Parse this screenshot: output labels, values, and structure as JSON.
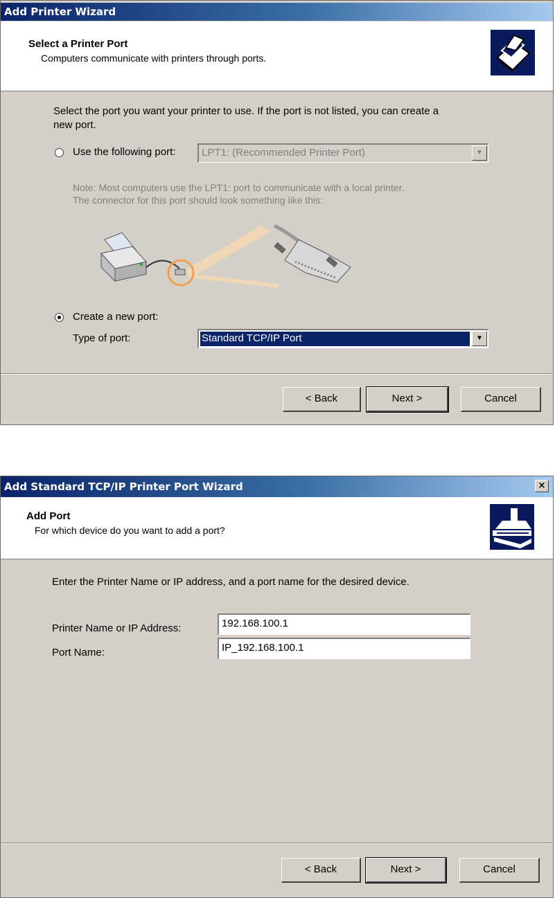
{
  "dialog1": {
    "title": "Add Printer Wizard",
    "header_title": "Select a Printer Port",
    "header_subtitle": "Computers communicate with printers through ports.",
    "instruction_line1": "Select the port you want your printer to use.  If the port is not listed, you can create a",
    "instruction_line2": "new port.",
    "use_port_label": "Use the following port:",
    "use_port_value": "LPT1: (Recommended Printer Port)",
    "note_line1": "Note: Most computers use the LPT1: port to communicate with a local printer.",
    "note_line2": "The connector for this port should look something like this:",
    "create_port_label": "Create a new port:",
    "type_of_port_label": "Type of port:",
    "type_of_port_value": "Standard TCP/IP Port",
    "selected_option": "create-new-port",
    "back_label": "< Back",
    "next_label": "Next >",
    "cancel_label": "Cancel"
  },
  "dialog2": {
    "title": "Add Standard TCP/IP Printer Port Wizard",
    "close_label": "×",
    "header_title": "Add Port",
    "header_subtitle": "For which device do you want to add a port?",
    "instruction": "Enter the Printer Name or IP address, and a port name for the desired device.",
    "printer_name_label": "Printer Name or IP Address:",
    "printer_name_value": "192.168.100.1",
    "port_name_label": "Port Name:",
    "port_name_value": "IP_192.168.100.1",
    "back_label": "< Back",
    "next_label": "Next >",
    "cancel_label": "Cancel"
  },
  "colors": {
    "title_gradient_start": "#0a246a",
    "title_gradient_end": "#a6caf0",
    "dialog_face": "#d4d0c8",
    "selection": "#0a246a",
    "connector_highlight": "#f0a050"
  }
}
